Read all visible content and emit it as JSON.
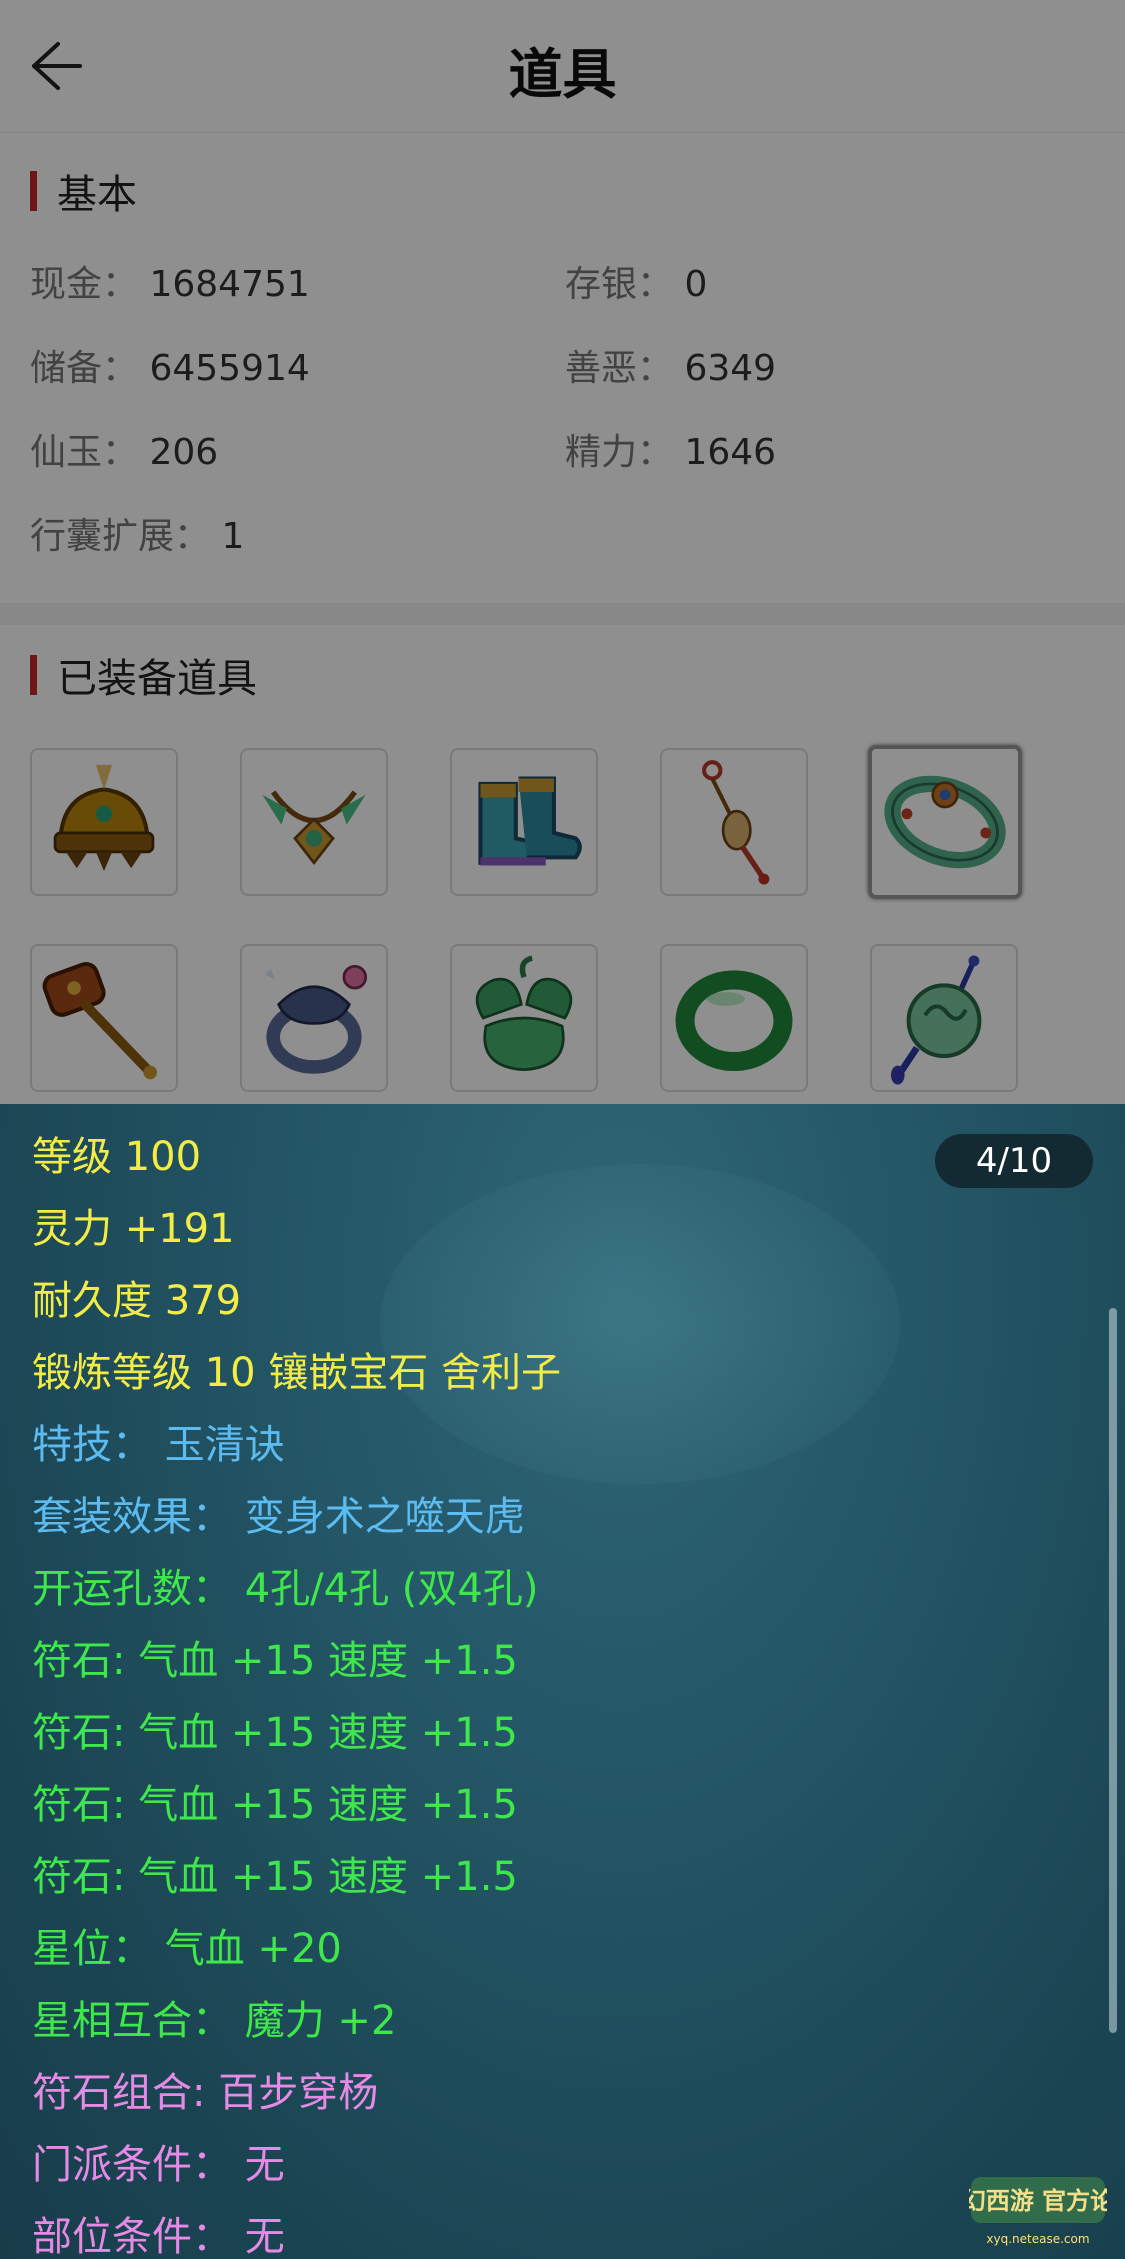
{
  "header": {
    "title": "道具"
  },
  "basic": {
    "title": "基本",
    "items": [
      {
        "label": "现金：",
        "value": "1684751"
      },
      {
        "label": "存银：",
        "value": "0"
      },
      {
        "label": "储备：",
        "value": "6455914"
      },
      {
        "label": "善恶：",
        "value": "6349"
      },
      {
        "label": "仙玉：",
        "value": "206"
      },
      {
        "label": "精力：",
        "value": "1646"
      },
      {
        "label": "行囊扩展：",
        "value": "1"
      }
    ]
  },
  "equipped": {
    "title": "已装备道具",
    "items": [
      {
        "icon": "helmet-icon"
      },
      {
        "icon": "necklace-icon"
      },
      {
        "icon": "boots-icon"
      },
      {
        "icon": "pendant-icon"
      },
      {
        "icon": "jade-bracelet-icon",
        "selected": true
      },
      {
        "icon": "hammer-icon"
      },
      {
        "icon": "ring-icon"
      },
      {
        "icon": "jade-carving-icon"
      },
      {
        "icon": "jade-bangle-icon"
      },
      {
        "icon": "jade-amulet-icon"
      }
    ]
  },
  "detail": {
    "counter": "4/10",
    "lines": [
      {
        "text": "等级 100",
        "color": "#f2ec45"
      },
      {
        "text": "灵力 +191",
        "color": "#f2ec45"
      },
      {
        "text": "耐久度 379",
        "color": "#f2ec45"
      },
      {
        "text": "锻炼等级 10 镶嵌宝石 舍利子",
        "color": "#f2ec45"
      },
      {
        "text": "特技：  玉清诀",
        "color": "#5cbcf2"
      },
      {
        "text": "套装效果：  变身术之噬天虎",
        "color": "#5cbcf2"
      },
      {
        "text": "开运孔数：  4孔/4孔 (双4孔)",
        "color": "#3fe84a"
      },
      {
        "text": "符石: 气血 +15 速度 +1.5",
        "color": "#3fe84a"
      },
      {
        "text": "符石: 气血 +15 速度 +1.5",
        "color": "#3fe84a"
      },
      {
        "text": "符石: 气血 +15 速度 +1.5",
        "color": "#3fe84a"
      },
      {
        "text": "符石: 气血 +15 速度 +1.5",
        "color": "#3fe84a"
      },
      {
        "text": "星位：  气血 +20",
        "color": "#3fe84a"
      },
      {
        "text": "星相互合：  魔力 +2",
        "color": "#3fe84a"
      },
      {
        "text": "符石组合: 百步穿杨",
        "color": "#e58be6"
      },
      {
        "text": "门派条件：  无",
        "color": "#e58be6"
      },
      {
        "text": "部位条件：  无",
        "color": "#e58be6"
      }
    ]
  },
  "watermark": {
    "text": "梦幻西游 官方论坛",
    "subtext": "xyq.netease.com"
  }
}
